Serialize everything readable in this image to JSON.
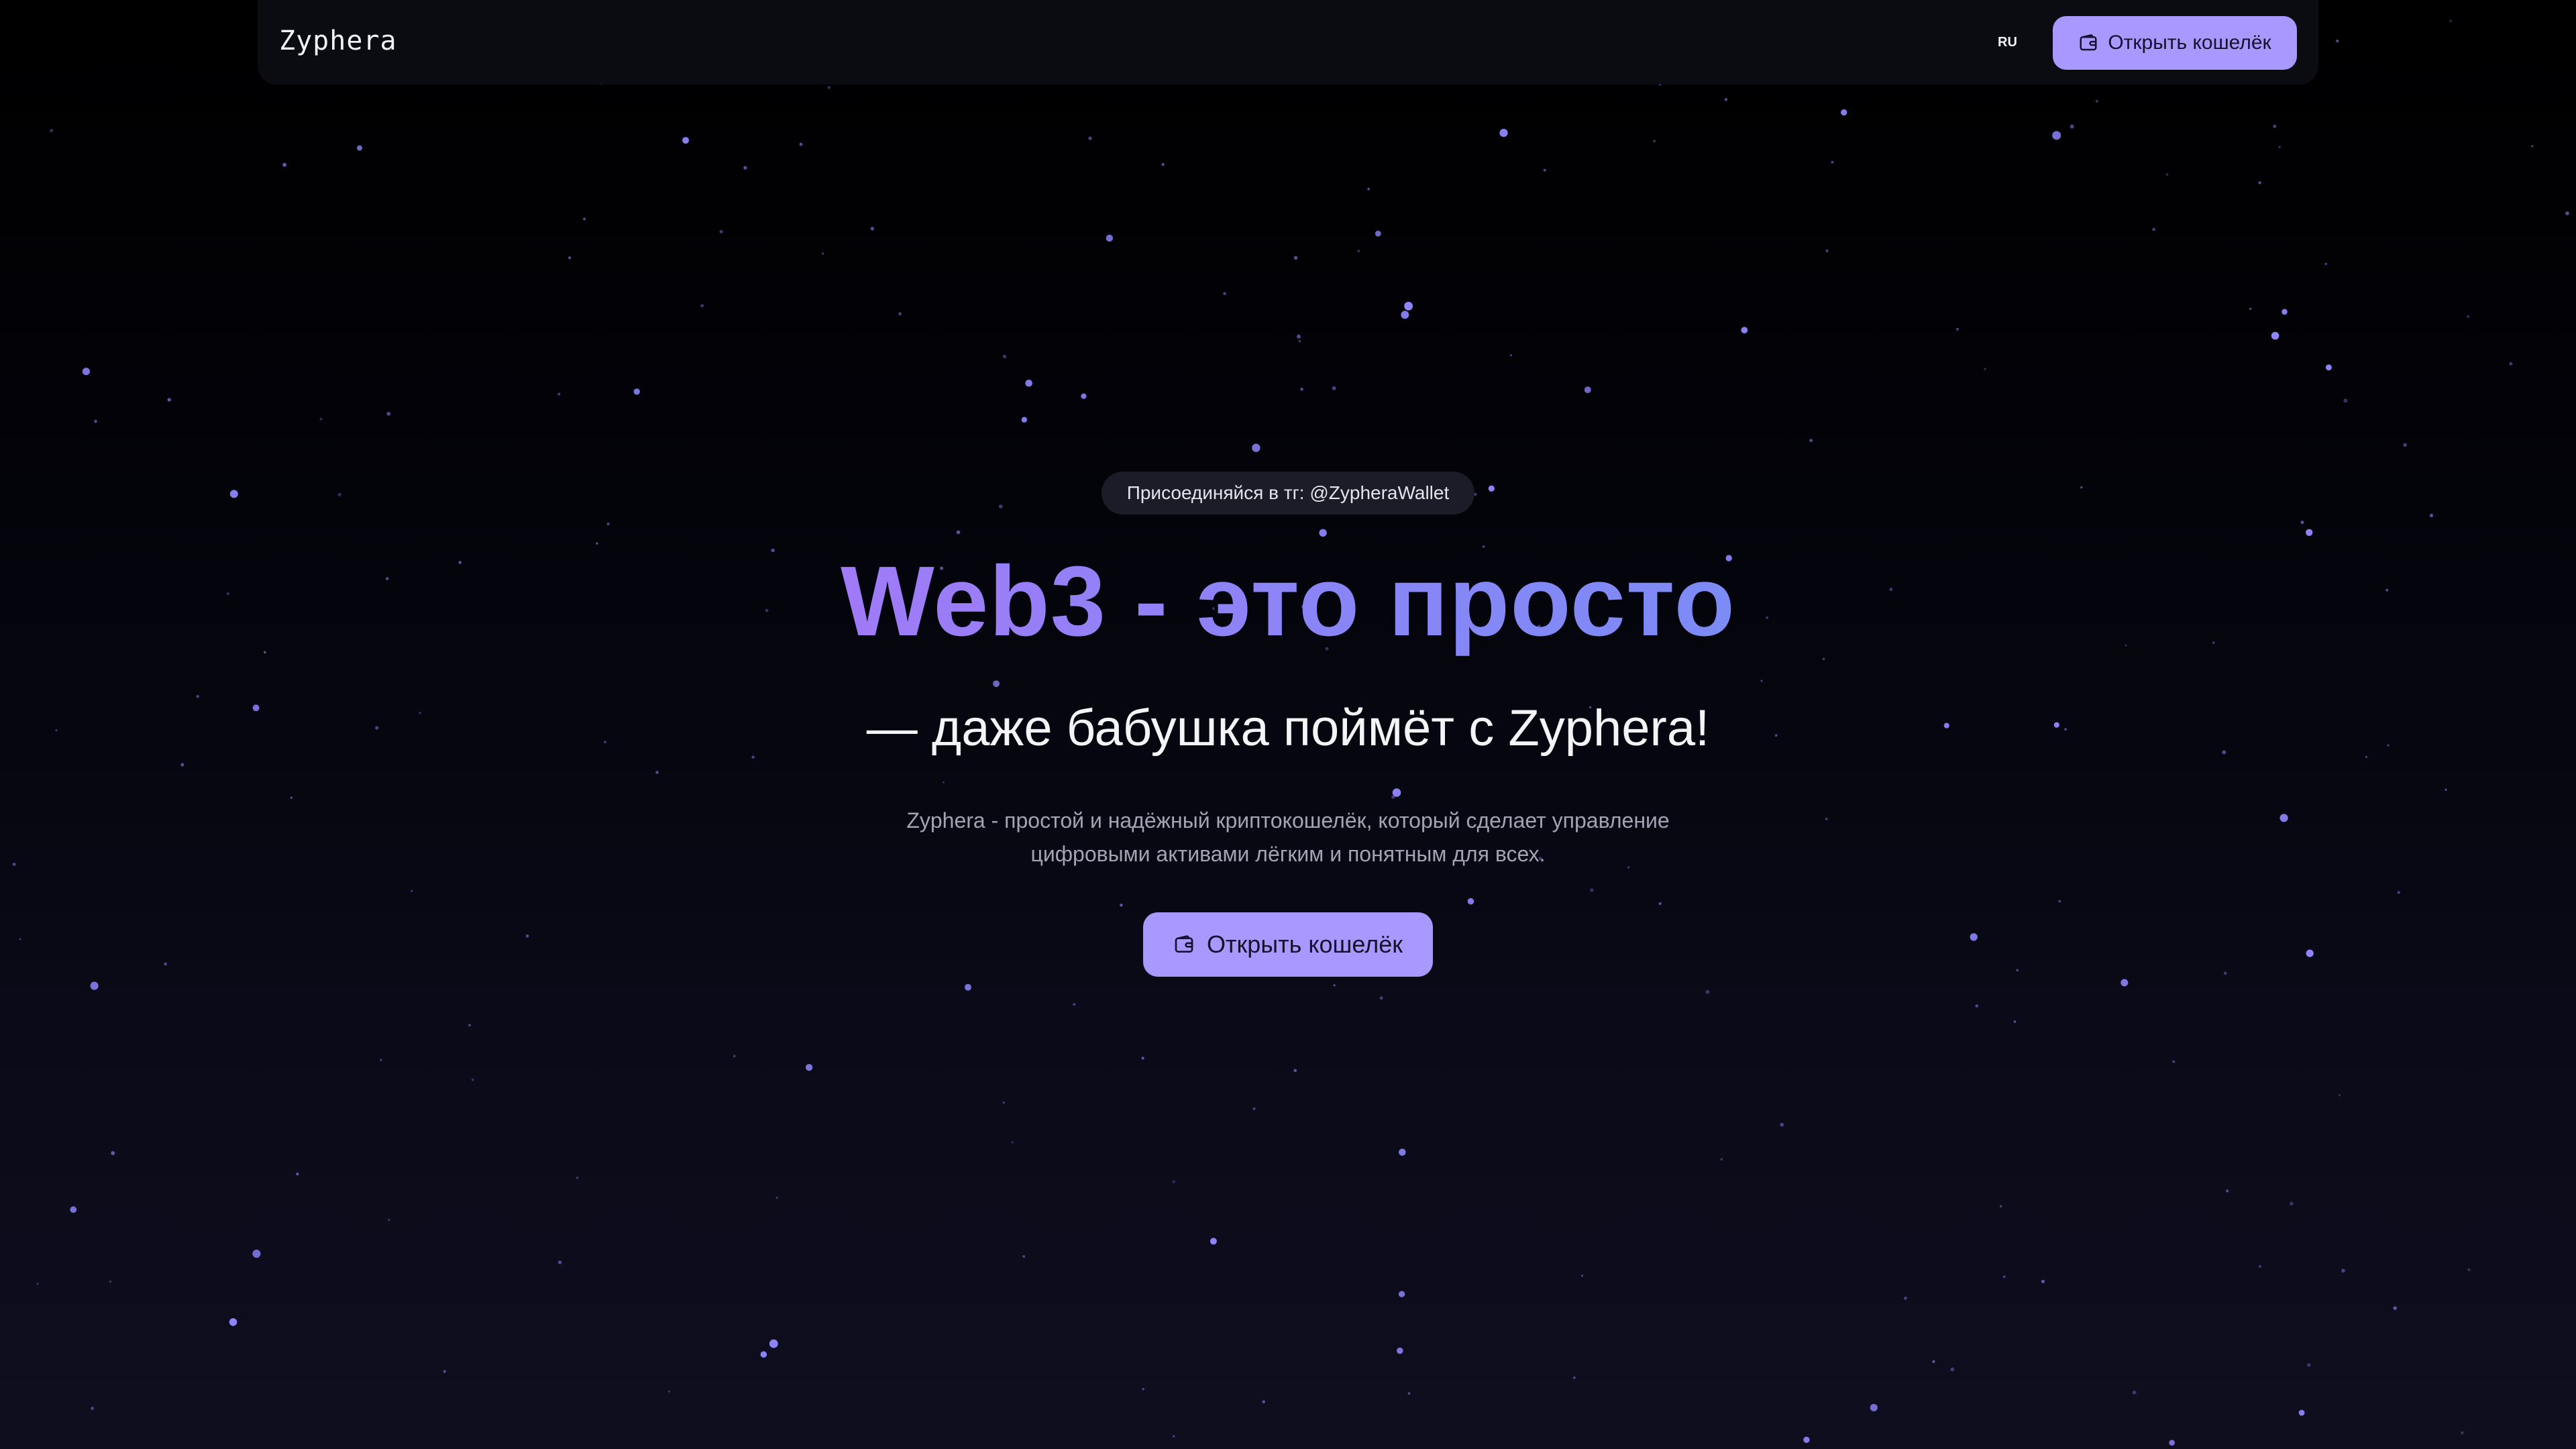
{
  "navbar": {
    "brand": "Zyphera",
    "language": "RU",
    "open_wallet_label": "Открыть кошелёк",
    "wallet_icon": "wallet-icon"
  },
  "hero": {
    "badge": "Присоединяйся в тг: @ZypheraWallet",
    "headline": "Web3 - это просто",
    "subheadline": "— даже бабушка поймёт с Zyphera!",
    "description": "Zyphera - простой и надёжный криптокошелёк, который сделает управление цифровыми активами лёгким и понятным для всех.",
    "cta_label": "Открыть кошелёк",
    "cta_icon": "wallet-icon"
  },
  "colors": {
    "background": "#000000",
    "accent": "#a898ff",
    "gradient_start": "#a07af7",
    "gradient_end": "#7c8bf5",
    "star": "#8f86ff"
  }
}
